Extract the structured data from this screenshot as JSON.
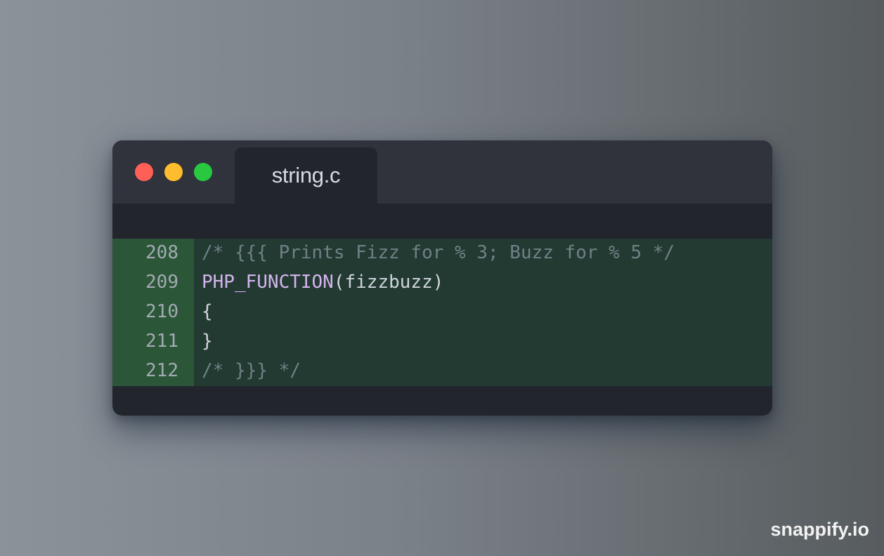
{
  "window": {
    "tab_title": "string.c"
  },
  "code": {
    "lines": [
      {
        "number": "208",
        "segments": [
          {
            "text": "/* {{{ Prints Fizz for % 3; Buzz for % 5 */",
            "kind": "comment"
          }
        ]
      },
      {
        "number": "209",
        "segments": [
          {
            "text": "PHP_FUNCTION",
            "kind": "macro"
          },
          {
            "text": "(fizzbuzz)",
            "kind": "plain"
          }
        ]
      },
      {
        "number": "210",
        "segments": [
          {
            "text": "{",
            "kind": "plain"
          }
        ]
      },
      {
        "number": "211",
        "segments": [
          {
            "text": "}",
            "kind": "plain"
          }
        ]
      },
      {
        "number": "212",
        "segments": [
          {
            "text": "/* }}} */",
            "kind": "comment"
          }
        ]
      }
    ]
  },
  "watermark": "snappify.io",
  "colors": {
    "close": "#fe5f57",
    "minimize": "#febc2e",
    "maximize": "#28c840",
    "added_line_gutter": "#2b5638",
    "added_line_content": "#233a32",
    "comment": "#6f8186",
    "macro": "#d3b4ee"
  }
}
